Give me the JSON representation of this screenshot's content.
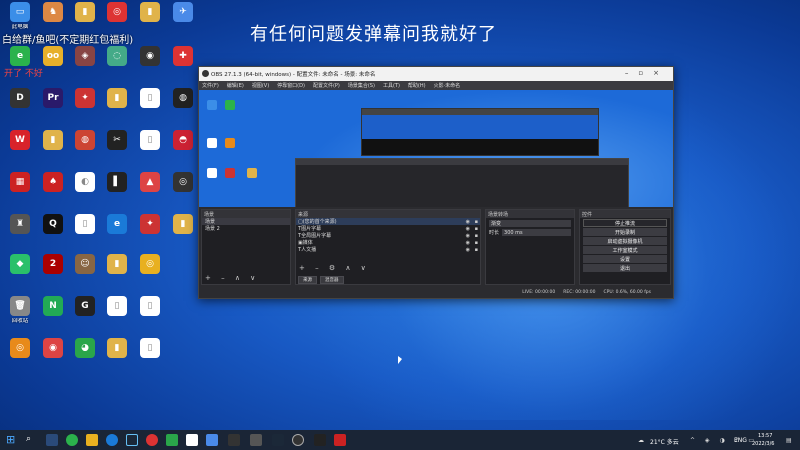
{
  "overlay": {
    "danmu_top": "有任何问题发弹幕问我就好了",
    "danmu_left": "白给群/鱼吧(不定期红包福利)",
    "danmu_red": "开了 不好"
  },
  "desktop_icons": [
    {
      "label": "此电脑",
      "color": "#3b8ee8",
      "glyph": "▭"
    },
    {
      "label": "",
      "color": "#2bb24c",
      "glyph": "e"
    },
    {
      "label": "",
      "color": "#333",
      "glyph": "D"
    },
    {
      "label": "",
      "color": "#d8232a",
      "glyph": "W"
    },
    {
      "label": "",
      "color": "#c22",
      "glyph": "▦"
    },
    {
      "label": "",
      "color": "#555",
      "glyph": "♜"
    },
    {
      "label": "",
      "color": "#2ac06a",
      "glyph": "◆"
    },
    {
      "label": "回收站",
      "color": "#888",
      "glyph": "🗑"
    },
    {
      "label": "",
      "color": "#e88a1a",
      "glyph": "◎"
    },
    {
      "label": "",
      "color": "#d84",
      "glyph": "♞"
    },
    {
      "label": "",
      "color": "#e7b02a",
      "glyph": "oo"
    },
    {
      "label": "",
      "color": "#2a1a6a",
      "glyph": "Pr"
    },
    {
      "label": "",
      "color": "#e0b34a",
      "glyph": "▮"
    },
    {
      "label": "",
      "color": "#c22",
      "glyph": "♠"
    },
    {
      "label": "",
      "color": "#111",
      "glyph": "Q"
    },
    {
      "label": "",
      "color": "#a00",
      "glyph": "2"
    },
    {
      "label": "",
      "color": "#2a5",
      "glyph": "N"
    },
    {
      "label": "",
      "color": "#d44",
      "glyph": "◉"
    },
    {
      "label": "",
      "color": "#e0b34a",
      "glyph": "▮"
    },
    {
      "label": "",
      "color": "#844",
      "glyph": "◈"
    },
    {
      "label": "",
      "color": "#c33",
      "glyph": "✦"
    },
    {
      "label": "",
      "color": "#c43",
      "glyph": "◍"
    },
    {
      "label": "",
      "color": "#fff",
      "glyph": "◐"
    },
    {
      "label": "",
      "color": "#fff",
      "glyph": "▯"
    },
    {
      "label": "",
      "color": "#864",
      "glyph": "☺"
    },
    {
      "label": "",
      "color": "#222",
      "glyph": "G"
    },
    {
      "label": "",
      "color": "#2aa64a",
      "glyph": "◕"
    },
    {
      "label": "",
      "color": "#d33",
      "glyph": "◎"
    },
    {
      "label": "",
      "color": "#4a8",
      "glyph": "◌"
    },
    {
      "label": "",
      "color": "#e0b34a",
      "glyph": "▮"
    },
    {
      "label": "",
      "color": "#222",
      "glyph": "✂"
    },
    {
      "label": "",
      "color": "#222",
      "glyph": "▌"
    },
    {
      "label": "",
      "color": "#1a7ad8",
      "glyph": "e"
    },
    {
      "label": "",
      "color": "#e0b34a",
      "glyph": "▮"
    },
    {
      "label": "",
      "color": "#fff",
      "glyph": "▯"
    },
    {
      "label": "",
      "color": "#e0b34a",
      "glyph": "▮"
    },
    {
      "label": "",
      "color": "#e0b34a",
      "glyph": "▮"
    },
    {
      "label": "",
      "color": "#333",
      "glyph": "◉"
    },
    {
      "label": "",
      "color": "#fff",
      "glyph": "▯"
    },
    {
      "label": "",
      "color": "#fff",
      "glyph": "▯"
    },
    {
      "label": "",
      "color": "#d44",
      "glyph": "▲"
    },
    {
      "label": "",
      "color": "#c33",
      "glyph": "✦"
    },
    {
      "label": "",
      "color": "#e8b020",
      "glyph": "◎"
    },
    {
      "label": "",
      "color": "#fff",
      "glyph": "▯"
    },
    {
      "label": "",
      "color": "#fff",
      "glyph": "▯"
    },
    {
      "label": "",
      "color": "#4a8ae8",
      "glyph": "✈"
    },
    {
      "label": "",
      "color": "#d33",
      "glyph": "✚"
    },
    {
      "label": "",
      "color": "#222",
      "glyph": "◍"
    },
    {
      "label": "",
      "color": "#c23",
      "glyph": "◓"
    },
    {
      "label": "",
      "color": "#333",
      "glyph": "◎"
    },
    {
      "label": "",
      "color": "#e0b34a",
      "glyph": "▮"
    },
    {
      "label": "",
      "color": "#4ab8e8",
      "glyph": "☁"
    },
    {
      "label": "",
      "color": "#333",
      "glyph": "◈"
    },
    {
      "label": "",
      "color": "#555",
      "glyph": "◆"
    },
    {
      "label": "",
      "color": "#333",
      "glyph": "◉"
    },
    {
      "label": "",
      "color": "#444",
      "glyph": "◎"
    },
    {
      "label": "",
      "color": "#d33",
      "glyph": "✚"
    }
  ],
  "obs": {
    "title": "OBS 27.1.3 (64-bit, windows) - 配置文件: 未命名 - 场景: 未命名",
    "menu": [
      "文件(F)",
      "编辑(E)",
      "视图(V)",
      "停靠窗口(D)",
      "配置文件(P)",
      "场景集合(S)",
      "工具(T)",
      "帮助(H)",
      "火影·未命名"
    ],
    "scenes": {
      "header": "场景",
      "items": [
        "场景",
        "场景 2"
      ]
    },
    "sources": {
      "header": "来源",
      "items": [
        {
          "name": "(您的首个来源)",
          "selected": true
        },
        {
          "name": "图片字幕"
        },
        {
          "name": "全局图片字幕"
        },
        {
          "name": "媒体"
        },
        {
          "name": "人文播"
        }
      ]
    },
    "mixer": {
      "header": "音频混音器",
      "tabs": [
        "来源",
        "混音器"
      ]
    },
    "transitions": {
      "header": "场景转场",
      "type": "渐变",
      "duration_label": "时长",
      "duration_value": "300 ms"
    },
    "controls": {
      "header": "控件",
      "buttons": [
        "停止推流",
        "开始录制",
        "启动虚拟摄像机",
        "工作室模式",
        "设置",
        "退出"
      ]
    },
    "status": {
      "live": "LIVE: 00:00:00",
      "rec": "REC: 00:00:00",
      "cpu": "CPU: 0.6%, 60.00 fps"
    }
  },
  "taskbar": {
    "weather": "21°C 多云",
    "lang": "ENG",
    "time": "13:57",
    "date": "2022/3/6"
  }
}
